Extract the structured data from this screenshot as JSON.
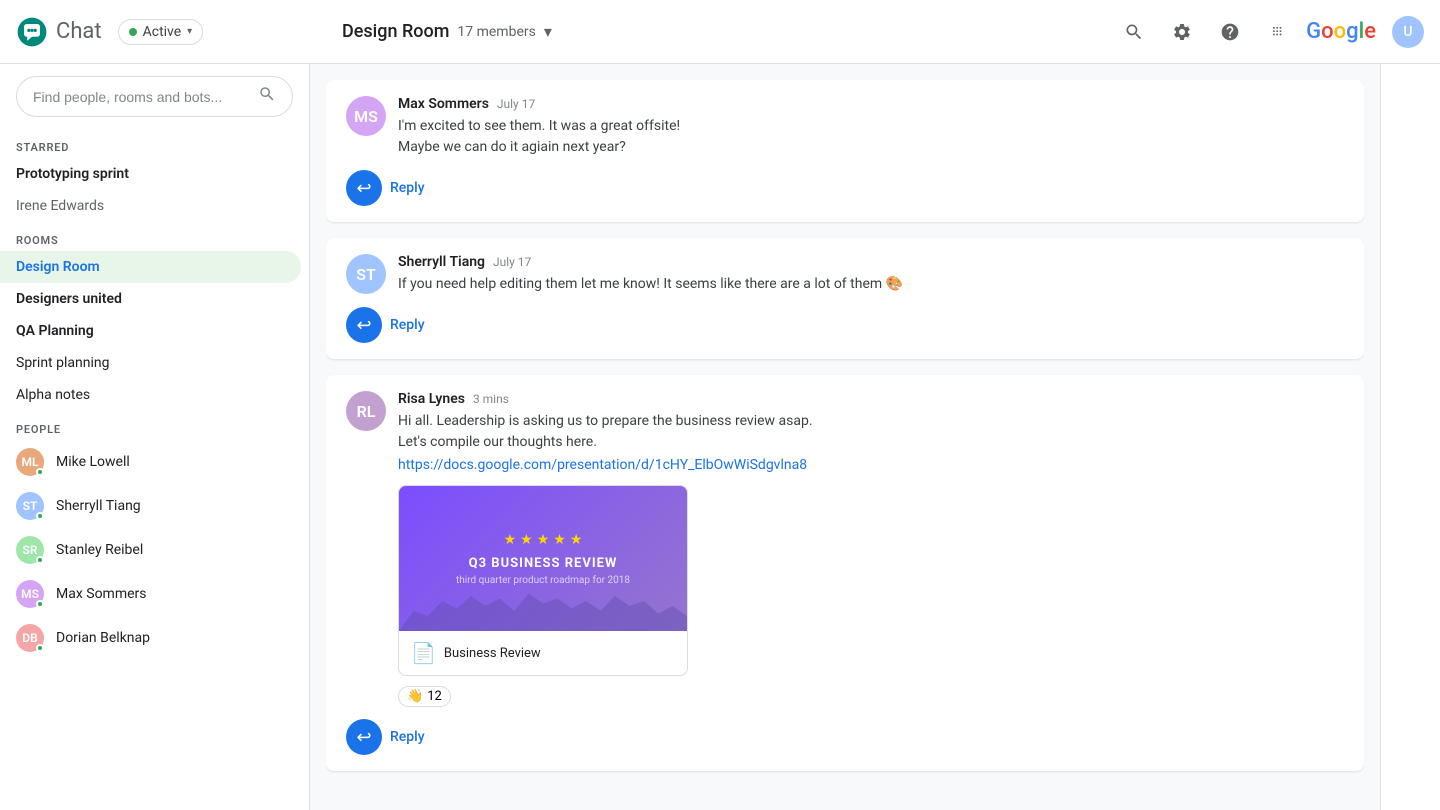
{
  "app": {
    "title": "Chat",
    "status": "Active",
    "google_label": "Google"
  },
  "header": {
    "room_name": "Design Room",
    "members": "17 members",
    "search_placeholder": "Find people, rooms and bots..."
  },
  "sidebar": {
    "starred_label": "STARRED",
    "rooms_label": "ROOMS",
    "people_label": "PEOPLE",
    "starred_items": [
      {
        "label": "Prototyping sprint",
        "bold": true
      },
      {
        "label": "Irene Edwards",
        "bold": false
      }
    ],
    "rooms": [
      {
        "label": "Design Room",
        "active": true,
        "bold": false
      },
      {
        "label": "Designers united",
        "bold": true
      },
      {
        "label": "QA Planning",
        "bold": true
      },
      {
        "label": "Sprint planning",
        "bold": false
      },
      {
        "label": "Alpha notes",
        "bold": false
      }
    ],
    "people": [
      {
        "label": "Mike Lowell",
        "color": "#e8a87c",
        "initials": "ML"
      },
      {
        "label": "Sherryll Tiang",
        "color": "#a0c4ff",
        "initials": "ST"
      },
      {
        "label": "Stanley Reibel",
        "color": "#9ee7a8",
        "initials": "SR"
      },
      {
        "label": "Max Sommers",
        "color": "#d4a5f5",
        "initials": "MS"
      },
      {
        "label": "Dorian Belknap",
        "color": "#f5a5a5",
        "initials": "DB"
      }
    ]
  },
  "messages": [
    {
      "id": "msg1",
      "author": "Max Sommers",
      "time": "July 17",
      "avatar_color": "#d4a5f5",
      "avatar_initials": "MS",
      "lines": [
        "I'm excited to see them. It was a great offsite!",
        "Maybe we can do it agiain next year?"
      ],
      "reply_label": "Reply"
    },
    {
      "id": "msg2",
      "author": "Sherryll Tiang",
      "time": "July 17",
      "avatar_color": "#a0c4ff",
      "avatar_initials": "ST",
      "lines": [
        "If you need help editing them let me know! It seems like there are a lot of them 🎨"
      ],
      "reply_label": "Reply"
    },
    {
      "id": "msg3",
      "author": "Risa Lynes",
      "time": "3 mins",
      "avatar_color": "#c2a0d0",
      "avatar_initials": "RL",
      "lines": [
        "Hi all. Leadership is asking us to prepare the business review asap.",
        "Let's compile our thoughts here."
      ],
      "link": "https://docs.google.com/presentation/d/1cHY_ElbOwWiSdgvlna8",
      "attachment": {
        "preview_title": "Q3 BUSINESS REVIEW",
        "preview_subtitle": "third quarter product roadmap for 2018",
        "stars": 5,
        "file_name": "Business Review"
      },
      "reaction": {
        "emoji": "👋",
        "count": "12"
      },
      "reply_label": "Reply"
    }
  ]
}
